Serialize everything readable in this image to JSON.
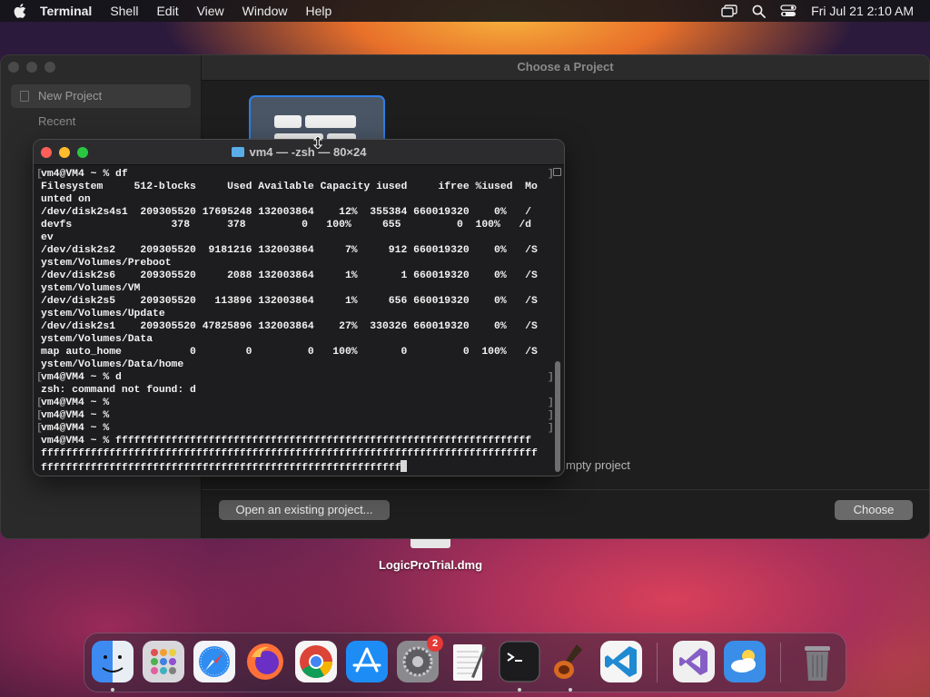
{
  "menubar": {
    "app_name": "Terminal",
    "items": [
      "Shell",
      "Edit",
      "View",
      "Window",
      "Help"
    ],
    "clock": "Fri Jul 21  2:10 AM"
  },
  "project_window": {
    "title": "Choose a Project",
    "sidebar": [
      "New Project",
      "Recent"
    ],
    "empty_project_label": "mpty project",
    "open_existing_button": "Open an existing project...",
    "choose_button": "Choose"
  },
  "desktop": {
    "file_name": "LogicProTrial.dmg"
  },
  "terminal": {
    "title": "vm4 — -zsh — 80×24",
    "lines": [
      {
        "text": "vm4@VM4 ~ % df",
        "mark": true
      },
      {
        "text": "Filesystem     512-blocks     Used Available Capacity iused     ifree %iused  Mo",
        "mark": false
      },
      {
        "text": "unted on",
        "mark": false
      },
      {
        "text": "/dev/disk2s4s1  209305520 17695248 132003864    12%  355384 660019320    0%   /",
        "mark": false
      },
      {
        "text": "devfs                378      378         0   100%     655         0  100%   /d",
        "mark": false
      },
      {
        "text": "ev",
        "mark": false
      },
      {
        "text": "/dev/disk2s2    209305520  9181216 132003864     7%     912 660019320    0%   /S",
        "mark": false
      },
      {
        "text": "ystem/Volumes/Preboot",
        "mark": false
      },
      {
        "text": "/dev/disk2s6    209305520     2088 132003864     1%       1 660019320    0%   /S",
        "mark": false
      },
      {
        "text": "ystem/Volumes/VM",
        "mark": false
      },
      {
        "text": "/dev/disk2s5    209305520   113896 132003864     1%     656 660019320    0%   /S",
        "mark": false
      },
      {
        "text": "ystem/Volumes/Update",
        "mark": false
      },
      {
        "text": "/dev/disk2s1    209305520 47825896 132003864    27%  330326 660019320    0%   /S",
        "mark": false
      },
      {
        "text": "ystem/Volumes/Data",
        "mark": false
      },
      {
        "text": "map auto_home           0        0         0   100%       0         0  100%   /S",
        "mark": false
      },
      {
        "text": "ystem/Volumes/Data/home",
        "mark": false
      },
      {
        "text": "vm4@VM4 ~ % d",
        "mark": true
      },
      {
        "text": "zsh: command not found: d",
        "mark": false
      },
      {
        "text": "vm4@VM4 ~ %",
        "mark": true
      },
      {
        "text": "vm4@VM4 ~ %",
        "mark": true
      },
      {
        "text": "vm4@VM4 ~ %",
        "mark": true
      },
      {
        "text": "vm4@VM4 ~ % fffffffffffffffffffffffffffffffffffffffffffffffffffffffffffffffffff",
        "mark": false
      },
      {
        "text": "ffffffffffffffffffffffffffffffffffffffffffffffffffffffffffffffffffffffffffffffff",
        "mark": false
      },
      {
        "text": "ffffffffffffffffffffffffffffffffffffffffffffffffffffffffff",
        "mark": false,
        "cursor": true
      }
    ]
  },
  "dock": {
    "apps": [
      {
        "name": "Finder",
        "icon": "finder-icon",
        "color": "#3d8bf0",
        "running": true
      },
      {
        "name": "Launchpad",
        "icon": "launchpad-icon",
        "color": "#d8d8dc",
        "running": false
      },
      {
        "name": "Safari",
        "icon": "safari-icon",
        "color": "#2f8cf0",
        "running": false
      },
      {
        "name": "Firefox",
        "icon": "firefox-icon",
        "color": "#ff7139",
        "running": false
      },
      {
        "name": "Chrome",
        "icon": "chrome-icon",
        "color": "#e8e8e8",
        "running": false
      },
      {
        "name": "App Store",
        "icon": "app-store-icon",
        "color": "#1e8cf5",
        "running": false
      },
      {
        "name": "System Settings",
        "icon": "settings-icon",
        "color": "#8a8a8e",
        "running": false,
        "badge": "2"
      },
      {
        "name": "TextEdit",
        "icon": "textedit-icon",
        "color": "#f2f2f2",
        "running": false
      },
      {
        "name": "Terminal",
        "icon": "terminal-icon",
        "color": "#1c1c1e",
        "running": true
      },
      {
        "name": "Instruments",
        "icon": "instruments-icon",
        "color": "#6a4a2a",
        "running": true
      },
      {
        "name": "Visual Studio Code",
        "icon": "vscode-icon",
        "color": "#f5f5f5",
        "running": false
      },
      {
        "name": "Visual Studio",
        "icon": "visual-studio-icon",
        "color": "#f0f0f0",
        "running": false
      },
      {
        "name": "Weather",
        "icon": "weather-icon",
        "color": "#3a8ee8",
        "running": false
      },
      {
        "name": "Trash",
        "icon": "trash-icon",
        "color": "#7a7a80",
        "running": false
      }
    ]
  }
}
